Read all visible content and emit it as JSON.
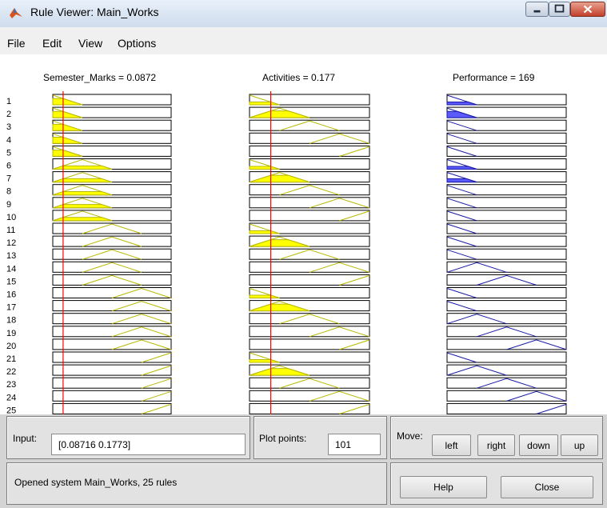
{
  "window": {
    "title": "Rule Viewer: Main_Works"
  },
  "menu": {
    "items": [
      "File",
      "Edit",
      "View",
      "Options"
    ]
  },
  "headers": {
    "input1": "Semester_Marks = 0.0872",
    "input2": "Activities = 0.177",
    "output": "Performance = 169"
  },
  "rules": {
    "numbers": [
      "1",
      "2",
      "3",
      "4",
      "5",
      "6",
      "7",
      "8",
      "9",
      "10",
      "11",
      "12",
      "13",
      "14",
      "15",
      "16",
      "17",
      "18",
      "19",
      "20",
      "21",
      "22",
      "23",
      "24",
      "25"
    ],
    "semester_mf": [
      1,
      1,
      1,
      1,
      1,
      2,
      2,
      2,
      2,
      2,
      3,
      3,
      3,
      3,
      3,
      4,
      4,
      4,
      4,
      4,
      5,
      5,
      5,
      5,
      5
    ],
    "activities_mf": [
      1,
      2,
      3,
      4,
      5,
      1,
      2,
      3,
      4,
      5,
      1,
      2,
      3,
      4,
      5,
      1,
      2,
      3,
      4,
      5,
      1,
      2,
      3,
      4,
      5
    ],
    "performance_mf": [
      1,
      1,
      1,
      1,
      1,
      1,
      1,
      1,
      1,
      1,
      1,
      1,
      1,
      2,
      3,
      1,
      1,
      2,
      3,
      4,
      1,
      2,
      3,
      4,
      5
    ],
    "input_values": {
      "semester_marks": 0.0872,
      "activities": 0.177
    }
  },
  "colors": {
    "mf_input": "#b8b800",
    "fill_input": "#ffff00",
    "mf_output": "#1a1aa6",
    "fill_output": "#5a5aff",
    "cursor_line": "#ff0000"
  },
  "bottom": {
    "input_label": "Input:",
    "input_value": "[0.08716 0.1773]",
    "plot_label": "Plot points:",
    "plot_value": "101",
    "move_label": "Move:",
    "move_buttons": [
      "left",
      "right",
      "down",
      "up"
    ],
    "status": "Opened system Main_Works, 25 rules",
    "help": "Help",
    "close": "Close"
  }
}
